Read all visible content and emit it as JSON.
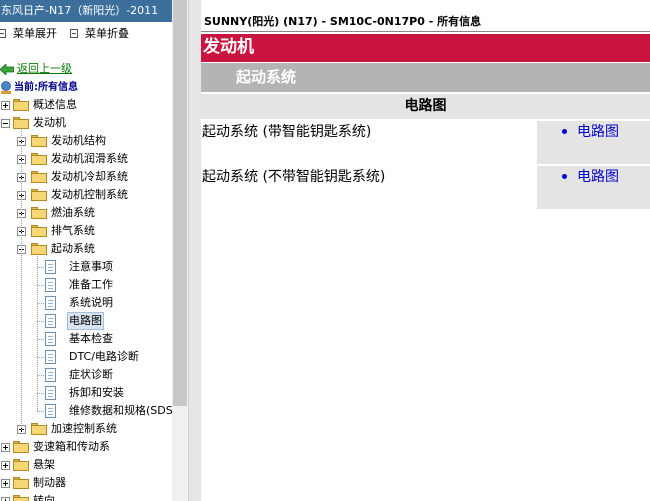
{
  "left_pane": {
    "title": "东风日产-N17（新阳光）-2011",
    "expand_all_label": "菜单展开",
    "collapse_all_label": "菜单折叠",
    "back_label": "返回上一级",
    "current_label": "当前:所有信息"
  },
  "tree": [
    {
      "label": "概述信息",
      "kind": "folder",
      "expander": "plus"
    },
    {
      "label": "发动机",
      "kind": "folder",
      "expander": "minus"
    },
    {
      "label": "发动机结构",
      "kind": "folder",
      "expander": "plus"
    },
    {
      "label": "发动机润滑系统",
      "kind": "folder",
      "expander": "plus"
    },
    {
      "label": "发动机冷却系统",
      "kind": "folder",
      "expander": "plus"
    },
    {
      "label": "发动机控制系统",
      "kind": "folder",
      "expander": "plus"
    },
    {
      "label": "燃油系统",
      "kind": "folder",
      "expander": "plus"
    },
    {
      "label": "排气系统",
      "kind": "folder",
      "expander": "plus"
    },
    {
      "label": "起动系统",
      "kind": "folder",
      "expander": "minus"
    },
    {
      "label": "注意事项",
      "kind": "page"
    },
    {
      "label": "准备工作",
      "kind": "page"
    },
    {
      "label": "系统说明",
      "kind": "page"
    },
    {
      "label": "电路图",
      "kind": "page",
      "selected": true
    },
    {
      "label": "基本检查",
      "kind": "page"
    },
    {
      "label": "DTC/电路诊断",
      "kind": "page"
    },
    {
      "label": "症状诊断",
      "kind": "page"
    },
    {
      "label": "拆卸和安装",
      "kind": "page"
    },
    {
      "label": "维修数据和规格(SDS)",
      "kind": "page"
    },
    {
      "label": "加速控制系统",
      "kind": "folder",
      "expander": "plus"
    },
    {
      "label": "变速箱和传动系",
      "kind": "folder",
      "expander": "plus"
    },
    {
      "label": "悬架",
      "kind": "folder",
      "expander": "plus"
    },
    {
      "label": "制动器",
      "kind": "folder",
      "expander": "plus"
    },
    {
      "label": "转向",
      "kind": "folder",
      "expander": "plus"
    }
  ],
  "content": {
    "doc_title": "SUNNY(阳光) (N17) - SM10C-0N17P0 - 所有信息",
    "section_title": "发动机",
    "subsection_title": "起动系统",
    "table_header": "电路图",
    "rows": [
      {
        "name": "起动系统 (带智能钥匙系统)",
        "link": "电路图"
      },
      {
        "name": "起动系统 (不带智能钥匙系统)",
        "link": "电路图"
      }
    ]
  },
  "colors": {
    "title_bar": "#3c6f9c",
    "section_bar": "#c8143f",
    "subsection_bar": "#b4b4b4",
    "link": "#0000cc",
    "back_link": "#0a7a0a",
    "current_label": "#00008b"
  },
  "icons": {
    "expand_all": "expand-all-icon",
    "collapse_all": "collapse-all-icon",
    "back": "green-back-arrow-icon",
    "current": "globe-icon",
    "folder": "folder-icon",
    "page": "document-icon",
    "bullet": "bullet-icon"
  }
}
